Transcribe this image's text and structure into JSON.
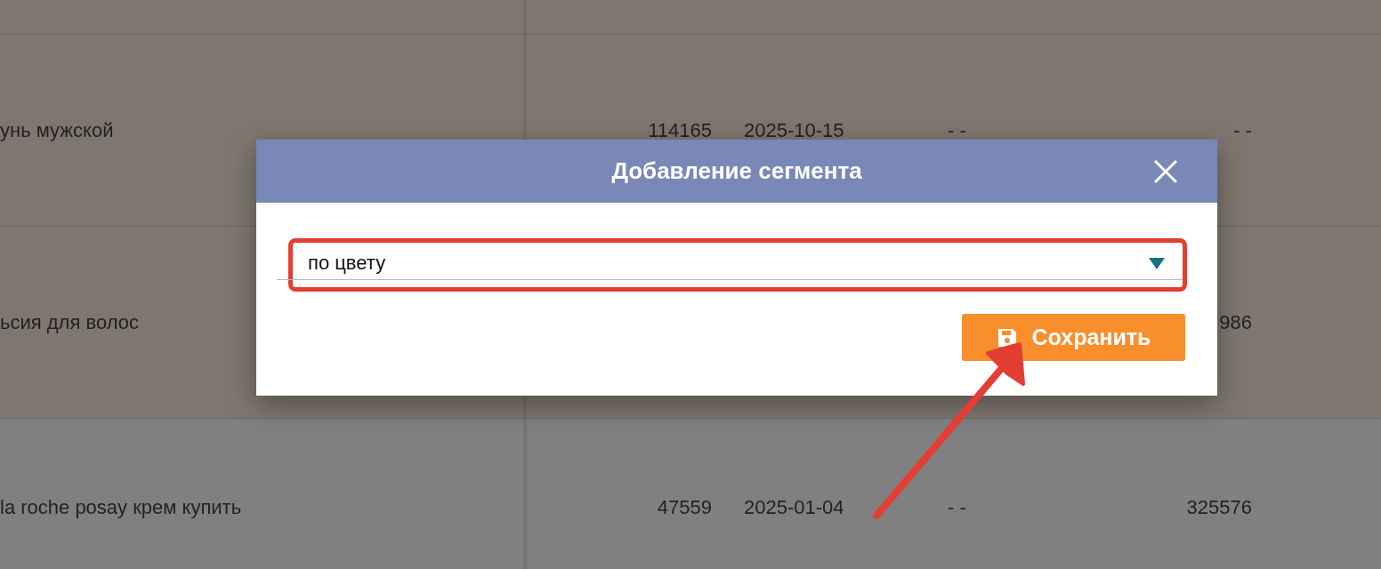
{
  "table": {
    "rows": [
      {
        "highlighted": true,
        "cells": []
      },
      {
        "highlighted": true,
        "cells": [
          "унь мужской",
          "114165",
          "2025-10-15",
          "- -",
          "- -"
        ]
      },
      {
        "highlighted": true,
        "cells": [
          "ьсия для волос",
          "",
          "",
          "",
          "986"
        ]
      },
      {
        "highlighted": false,
        "cells": [
          "la roche posay крем купить",
          "47559",
          "2025-01-04",
          "- -",
          "325576"
        ]
      }
    ]
  },
  "dialog": {
    "title": "Добавление сегмента",
    "select": {
      "value": "по цвету",
      "highlighted": true
    },
    "save_button": "Сохранить"
  }
}
